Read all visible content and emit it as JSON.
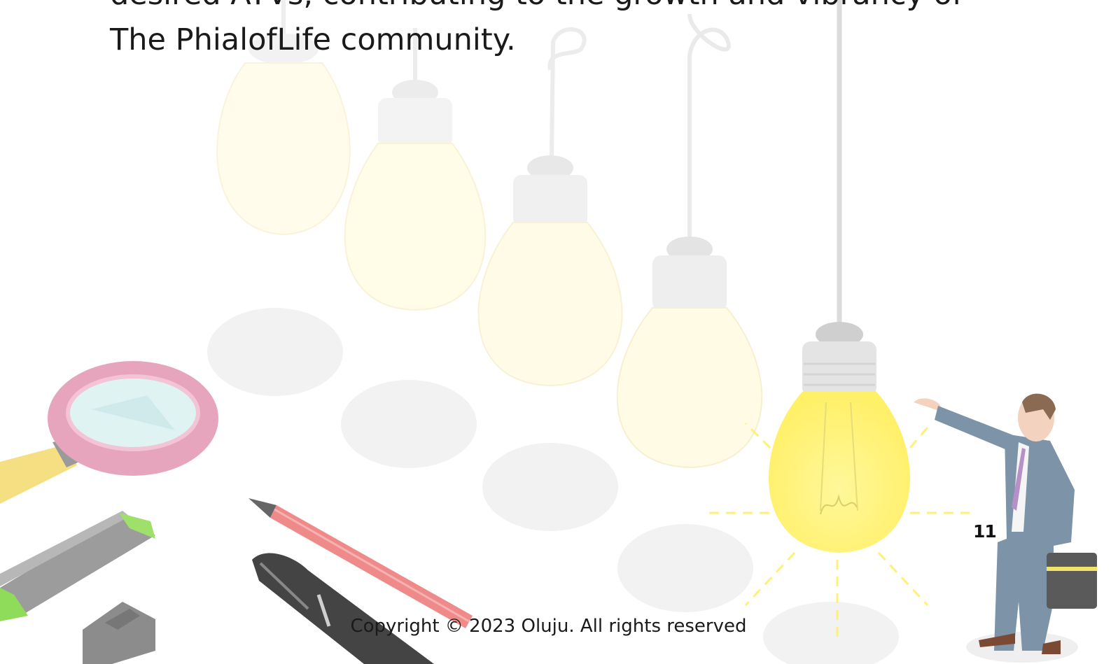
{
  "document": {
    "body_lines": [
      "desired ATVs, contributing to the growth and vibrancy of",
      "The PhialofLife community."
    ],
    "page_number": "11",
    "footer": "Copyright © 2023 Oluju. All rights reserved"
  },
  "colors": {
    "text": "#1a1a1a",
    "bulb_glow": "#fff27a",
    "faded_bulb": "#fffbe0",
    "magnifier_rim": "#e79cb7",
    "pencil": "#ef8a8a",
    "suit": "#7c93a8"
  },
  "illustration": {
    "bulbs": "light-bulbs-illustration",
    "person": "businessman-illustration",
    "tools": "stationery-illustration"
  }
}
